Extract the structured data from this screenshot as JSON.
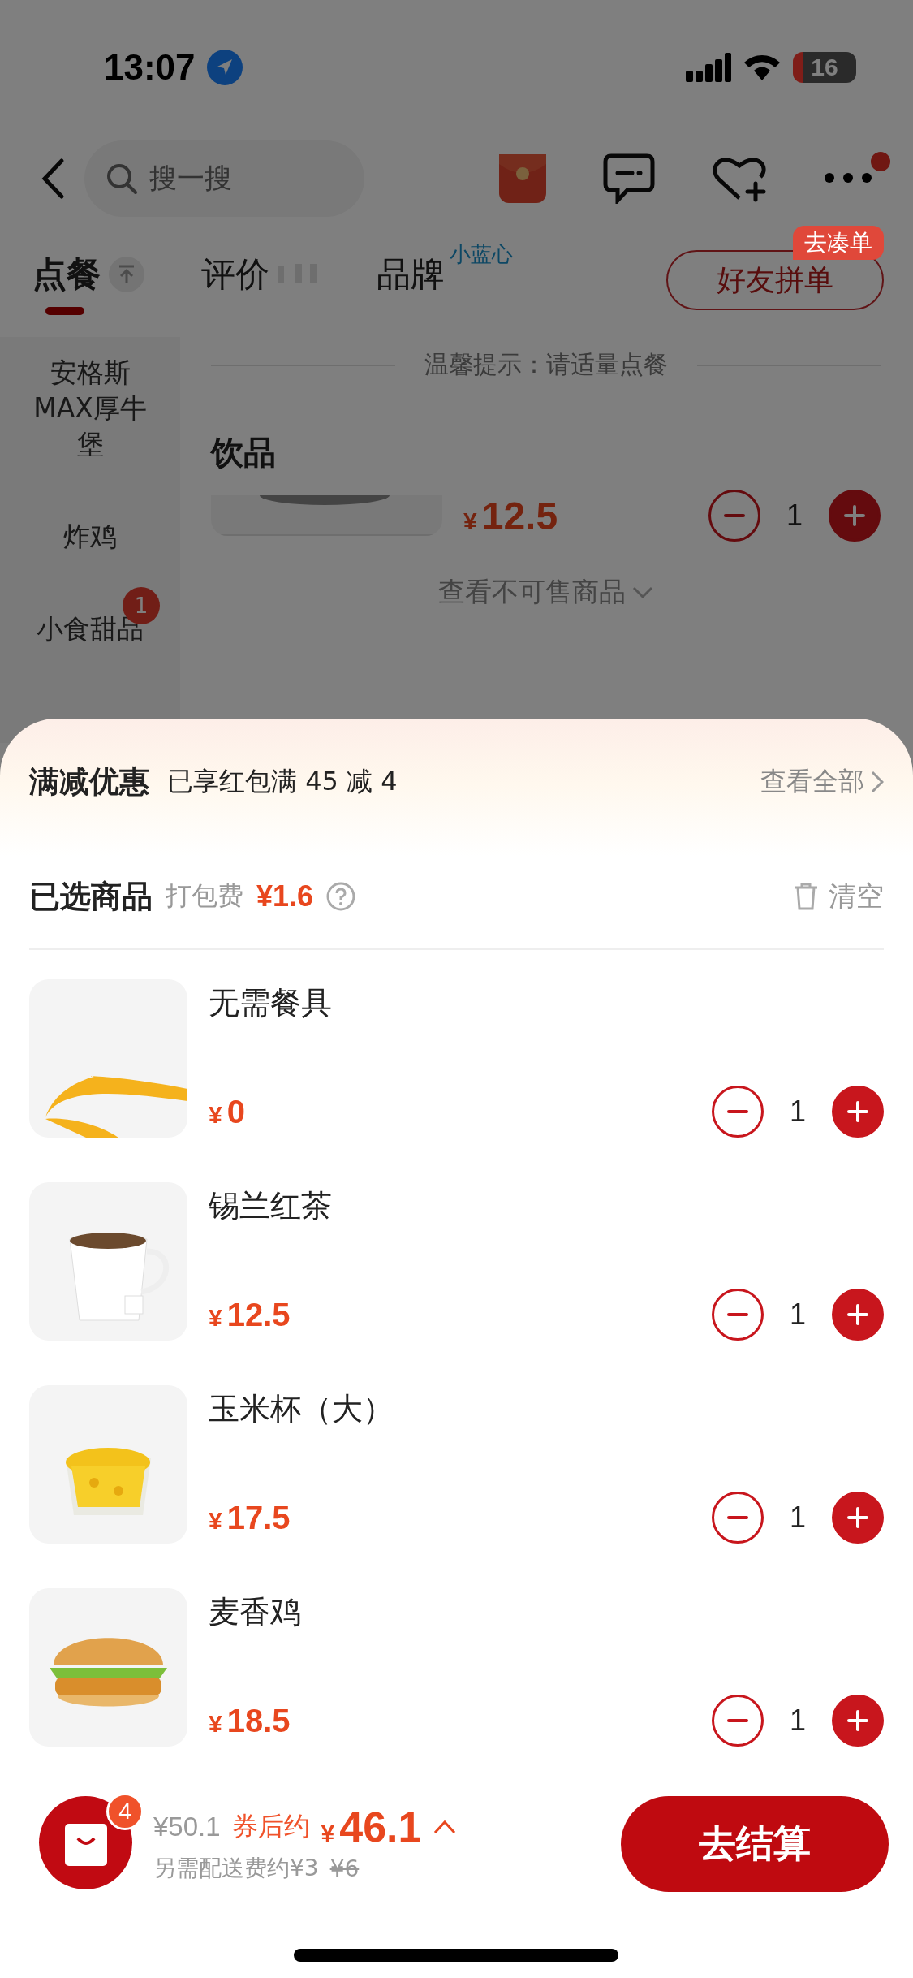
{
  "status_bar": {
    "time": "13:07",
    "battery": "16"
  },
  "nav": {
    "search": {
      "placeholder": "搜一搜"
    },
    "more_has_dot": true
  },
  "tabs": [
    {
      "label": "点餐",
      "selected": true
    },
    {
      "label": "评价",
      "selected": false
    },
    {
      "label": "品牌",
      "selected": false,
      "tag": "小蓝心"
    }
  ],
  "group_order": {
    "label": "好友拼单",
    "badge": "去凑单"
  },
  "categories": [
    {
      "label": "安格斯MAX厚牛堡"
    },
    {
      "label": "炸鸡"
    },
    {
      "label": "小食甜品",
      "badge": "1"
    }
  ],
  "notice": "温馨提示：请适量点餐",
  "section_title": "饮品",
  "menu_item": {
    "currency": "¥",
    "price": "12.5",
    "quantity": "1"
  },
  "unavailable_link": "查看不可售商品",
  "cart_sheet": {
    "promo": {
      "title": "满减优惠",
      "text": "已享红包满 45 减 4",
      "link": "查看全部"
    },
    "header": {
      "title": "已选商品",
      "fee_label": "打包费",
      "fee": "¥1.6",
      "clear": "清空"
    },
    "items": [
      {
        "name": "无需餐具",
        "currency": "¥",
        "price": "0",
        "quantity": "1"
      },
      {
        "name": "锡兰红茶",
        "currency": "¥",
        "price": "12.5",
        "quantity": "1"
      },
      {
        "name": "玉米杯（大）",
        "currency": "¥",
        "price": "17.5",
        "quantity": "1"
      },
      {
        "name": "麦香鸡",
        "currency": "¥",
        "price": "18.5",
        "quantity": "1"
      }
    ]
  },
  "checkout_bar": {
    "count": "4",
    "original_price": "¥50.1",
    "coupon_label": "券后约",
    "final_currency": "¥",
    "final_price": "46.1",
    "delivery_text": "另需配送费约¥3",
    "delivery_original": "¥6",
    "button": "去结算"
  }
}
